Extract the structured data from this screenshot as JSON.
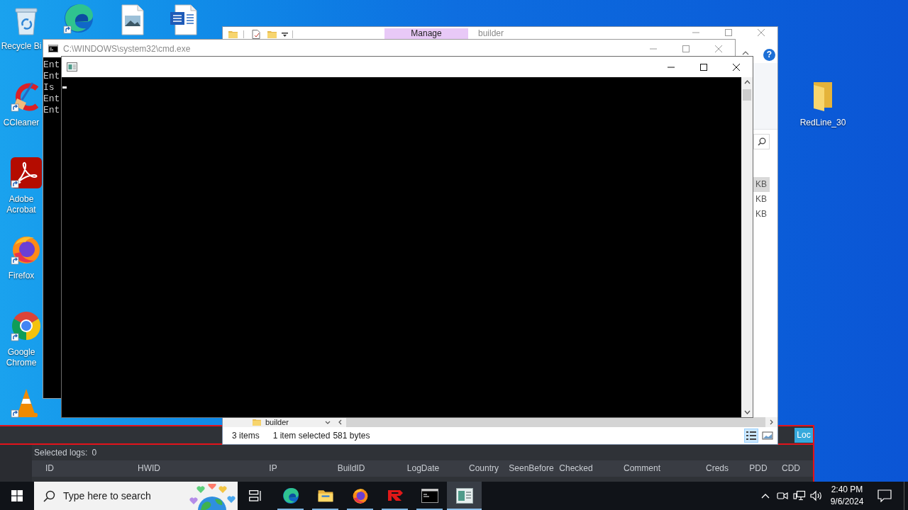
{
  "desktop": {
    "icons": [
      {
        "kind": "recycle-bin",
        "label": "Recycle Bi",
        "shortcut": false
      },
      {
        "kind": "edge",
        "shortcut": true
      },
      {
        "kind": "image-file",
        "shortcut": false
      },
      {
        "kind": "word-file",
        "shortcut": false
      },
      {
        "kind": "ccleaner",
        "label": "CCleaner",
        "shortcut": true
      },
      {
        "kind": "acrobat",
        "label": "Adobe Acrobat",
        "shortcut": true
      },
      {
        "kind": "firefox",
        "label": "Firefox",
        "shortcut": true
      },
      {
        "kind": "chrome",
        "label": "Google Chrome",
        "shortcut": true
      },
      {
        "kind": "vlc",
        "shortcut": true
      },
      {
        "kind": "folder",
        "label": "RedLine_30",
        "shortcut": false
      }
    ]
  },
  "redline_panel": {
    "tile": "Loc",
    "selected_logs_label": "Selected logs:",
    "selected_logs_count": "0",
    "columns": [
      "ID",
      "HWID",
      "IP",
      "BuildID",
      "LogDate",
      "Country",
      "SeenBefore",
      "Checked",
      "Comment",
      "Creds",
      "PDD",
      "CDD"
    ]
  },
  "explorer_window": {
    "context_tab": "Manage",
    "title": "builder",
    "help": "?",
    "file_sizes": [
      {
        "text": "KB",
        "selected": true
      },
      {
        "text": "KB",
        "selected": false
      },
      {
        "text": "KB",
        "selected": false
      }
    ],
    "nav_item": "builder",
    "status": {
      "items": "3 items",
      "selection": "1 item selected",
      "size": "581 bytes"
    },
    "views": [
      {
        "kind": "details",
        "selected": true
      },
      {
        "kind": "large-icons",
        "selected": false
      }
    ]
  },
  "cmd_window": {
    "title": "C:\\WINDOWS\\system32\\cmd.exe",
    "lines": [
      "Ent",
      "Ent",
      "Is",
      "Ent",
      "Ent"
    ]
  },
  "taskbar": {
    "search": {
      "placeholder": "Type here to search"
    },
    "apps": [
      {
        "kind": "task-view",
        "running": false,
        "active": false
      },
      {
        "kind": "edge",
        "running": true,
        "active": false
      },
      {
        "kind": "explorer",
        "running": true,
        "active": false
      },
      {
        "kind": "firefox",
        "running": true,
        "active": false
      },
      {
        "kind": "redline",
        "running": true,
        "active": false
      },
      {
        "kind": "cmd",
        "running": true,
        "active": false
      },
      {
        "kind": "console",
        "running": true,
        "active": true
      }
    ],
    "clock": {
      "time": "2:40 PM",
      "date": "9/6/2024"
    }
  }
}
